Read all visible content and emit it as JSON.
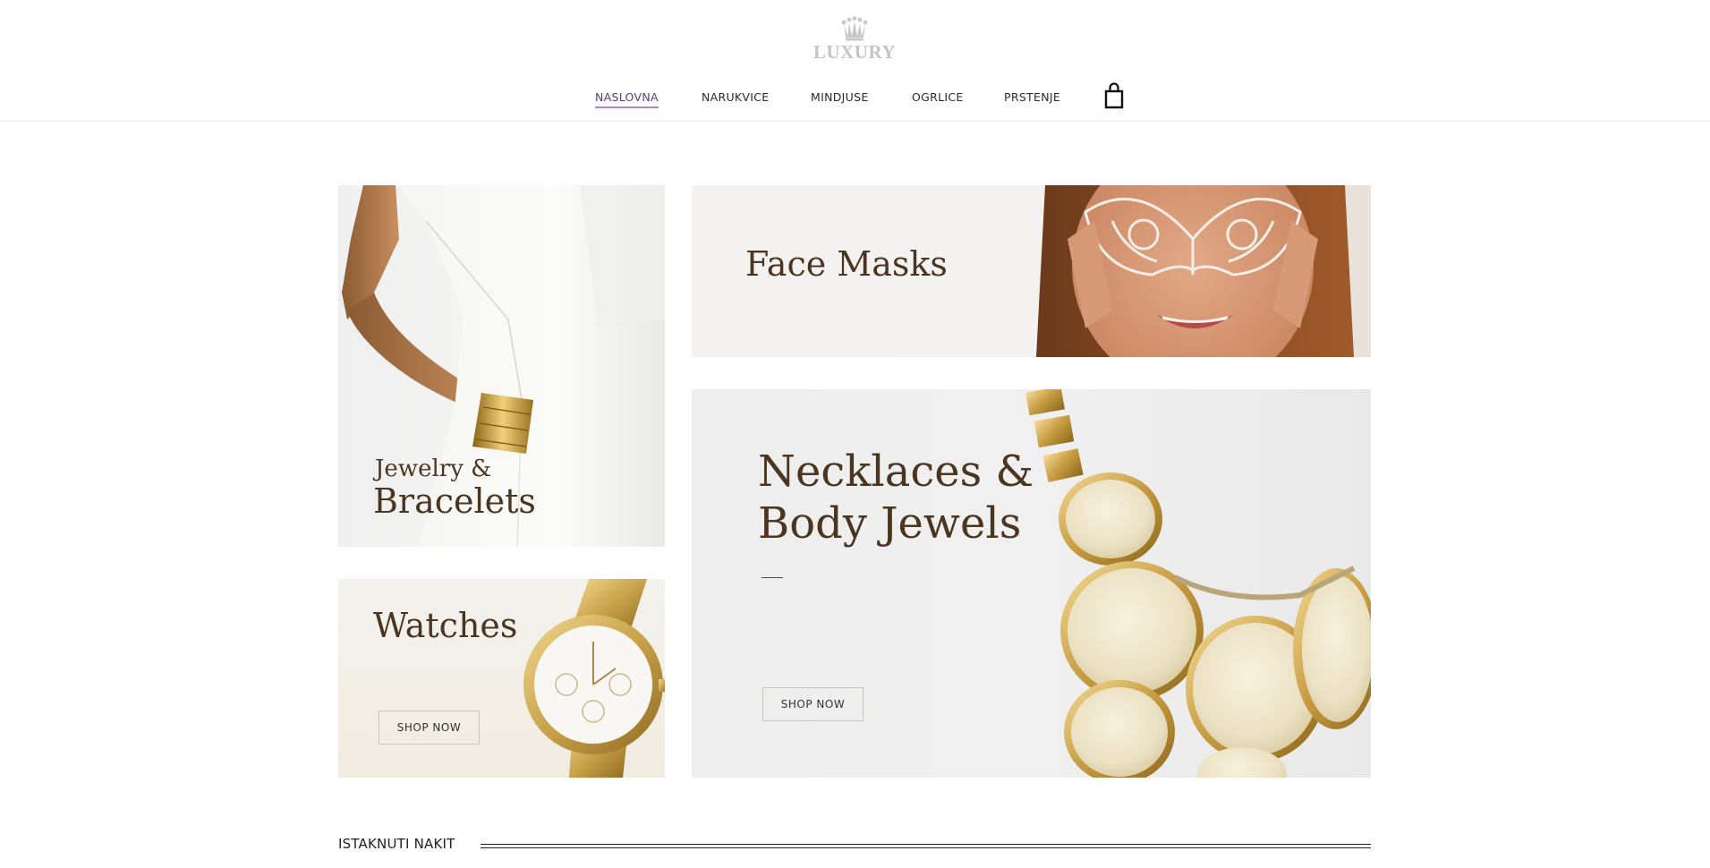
{
  "header": {
    "logo_text": "LUXURY",
    "nav": [
      {
        "label": "NASLOVNA",
        "active": true
      },
      {
        "label": "NARUKVICE",
        "active": false
      },
      {
        "label": "MINDJUSE",
        "active": false
      },
      {
        "label": "OGRLICE",
        "active": false
      },
      {
        "label": "PRSTENJE",
        "active": false
      }
    ],
    "accent_color": "#a98bc7"
  },
  "tiles": {
    "bracelets": {
      "title_line1": "Jewelry &",
      "title_line2": "Bracelets"
    },
    "masks": {
      "title": "Face Masks"
    },
    "watches": {
      "title": "Watches",
      "button": "SHOP NOW"
    },
    "necklaces": {
      "title_line1": "Necklaces &",
      "title_line2": "Body Jewels",
      "button": "SHOP NOW"
    }
  },
  "featured": {
    "title": "ISTAKNUTI NAKIT"
  },
  "colors": {
    "title_brown": "#4a3620",
    "gold": "#c9a24a"
  },
  "icons": {
    "logo": "crown-icon",
    "cart": "shopping-bag-icon"
  }
}
